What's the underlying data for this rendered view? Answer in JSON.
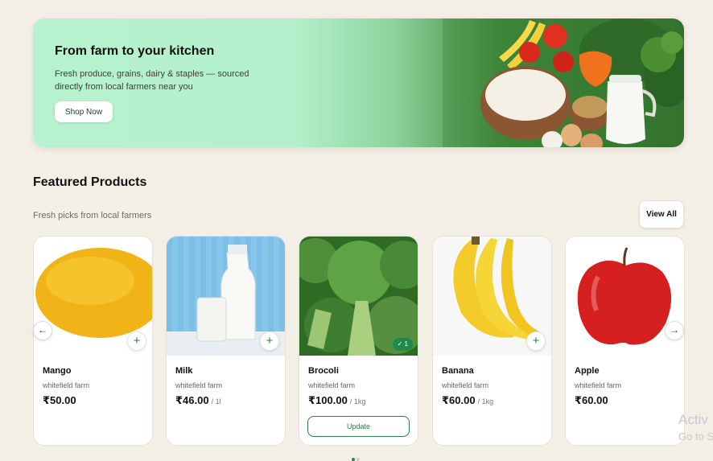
{
  "hero": {
    "title": "From farm to your kitchen",
    "subtitle": "Fresh produce, grains, dairy & staples — sourced directly from local farmers near you",
    "cta": "Shop Now"
  },
  "featured": {
    "title": "Featured Products",
    "subtitle": "Fresh picks from local farmers",
    "view_all": "View All"
  },
  "products": [
    {
      "name": "Mango",
      "farm": "whitefield farm",
      "price": "₹50.00",
      "unit": ""
    },
    {
      "name": "Milk",
      "farm": "whitefield farm",
      "price": "₹46.00",
      "unit": "/ 1l"
    },
    {
      "name": "Brocoli",
      "farm": "whitefield farm",
      "price": "₹100.00",
      "unit": "/ 1kg",
      "in_cart_qty": "✓ 1",
      "update_label": "Update"
    },
    {
      "name": "Banana",
      "farm": "whitefield farm",
      "price": "₹60.00",
      "unit": "/ 1kg"
    },
    {
      "name": "Apple",
      "farm": "whitefield farm",
      "price": "₹60.00",
      "unit": ""
    }
  ],
  "icons": {
    "add": "plus-icon",
    "prev": "arrow-left-icon",
    "next": "arrow-right-icon"
  },
  "watermark": {
    "line1": "Activ",
    "line2": "Go to S"
  },
  "colors": {
    "accent": "#2e7d4f",
    "hero_start": "#b7f2cf",
    "background": "#f4efe6"
  }
}
